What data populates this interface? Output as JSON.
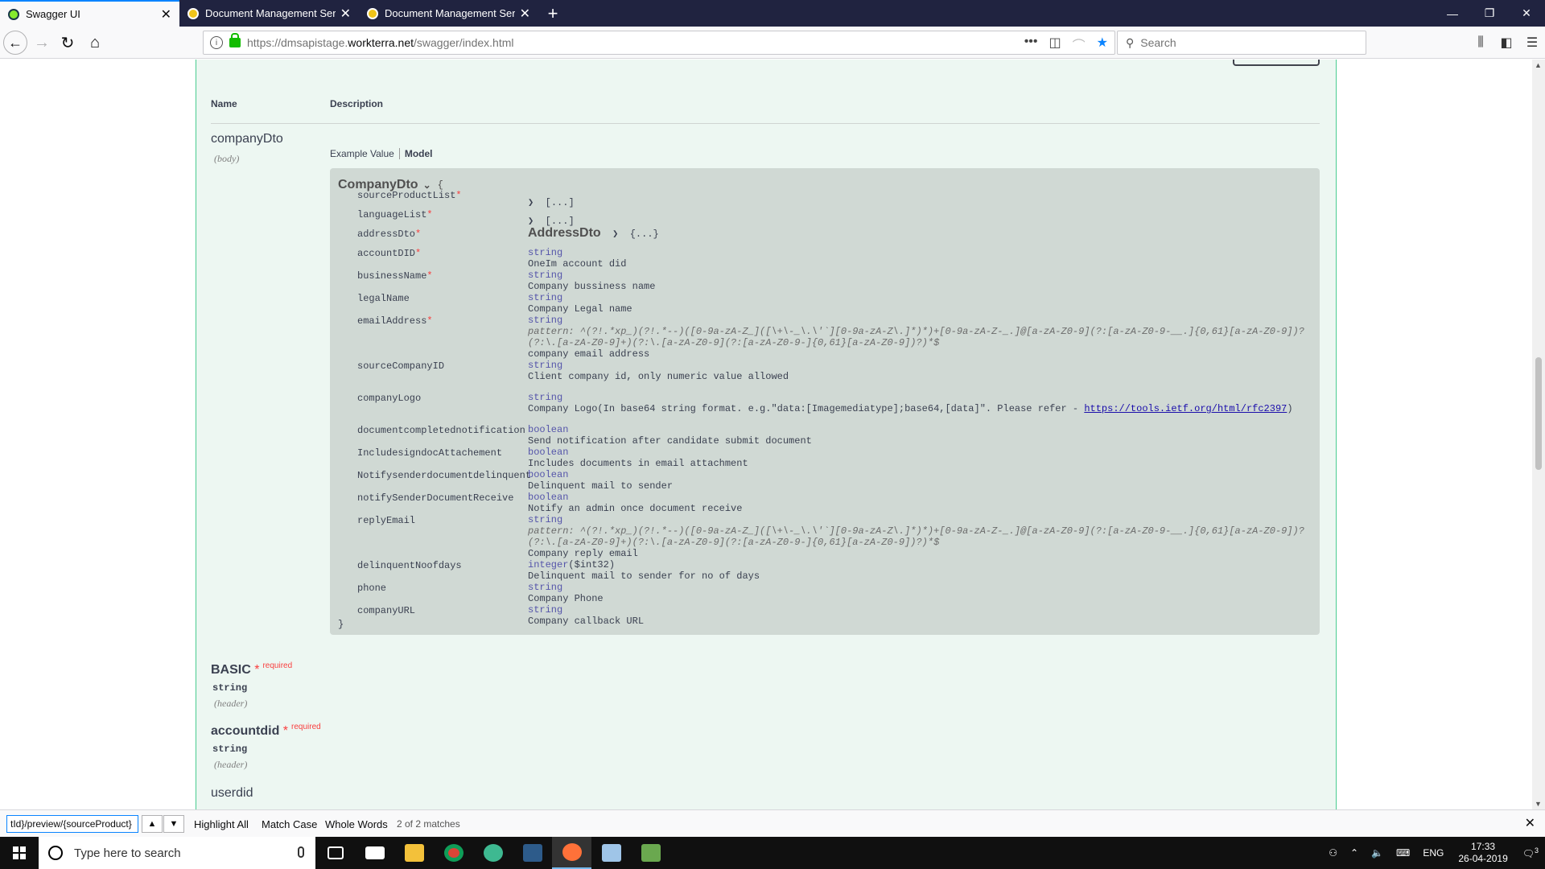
{
  "browser": {
    "tabs": [
      {
        "title": "Swagger UI",
        "active": true
      },
      {
        "title": "Document Management Servic",
        "active": false
      },
      {
        "title": "Document Management Servic",
        "active": false
      }
    ],
    "url_prefix": "https://dmsapistage.",
    "url_host": "workterra.net",
    "url_path": "/swagger/index.html",
    "search_placeholder": "Search"
  },
  "params_table": {
    "header_name": "Name",
    "header_description": "Description",
    "params": [
      {
        "name": "companyDto",
        "in": "(body)"
      },
      {
        "name": "BASIC",
        "required_star": "*",
        "required_label": "required",
        "type": "string",
        "in": "(header)"
      },
      {
        "name": "accountdid",
        "required_star": "*",
        "required_label": "required",
        "type": "string",
        "in": "(header)"
      },
      {
        "name": "userdid"
      }
    ]
  },
  "model_tabs": {
    "example": "Example Value",
    "model": "Model"
  },
  "model": {
    "title": "CompanyDto",
    "open_brace": "{",
    "close_brace": "}",
    "collapsed": "[...]",
    "collapsed_obj": "{...}",
    "address_type": "AddressDto",
    "props": {
      "sourceProductList": "sourceProductList",
      "languageList": "languageList",
      "addressDto": "addressDto",
      "accountDID": "accountDID",
      "businessName": "businessName",
      "legalName": "legalName",
      "emailAddress": "emailAddress",
      "sourceCompanyID": "sourceCompanyID",
      "companyLogo": "companyLogo",
      "documentcompletednotification": "documentcompletednotification",
      "IncludesigndocAttachement": "IncludesigndocAttachement",
      "NotifysenderdocumentdelinquentHidden": "Notifysenderdocumentdelinquent",
      "notifySenderDocumentReceive": "notifySenderDocumentReceive",
      "replyEmail": "replyEmail",
      "delinquentNoofdays": "delinquentNoofdays",
      "phone": "phone",
      "companyURL": "companyURL"
    },
    "req_star": "*",
    "types": {
      "string": "string",
      "boolean": "boolean",
      "integer": "integer",
      "int32": "($int32)"
    },
    "descs": {
      "accountDID": "OneIm account did",
      "businessName": "Company bussiness name",
      "legalName": "Company Legal name",
      "emailAddress": "company email address",
      "sourceCompanyID": "Client company id, only numeric value allowed",
      "companyLogo_pre": "Company Logo(In base64 string format. e.g.\"data:[Imagemediatype];base64,[data]\". Please refer - ",
      "companyLogo_link": "https://tools.ietf.org/html/rfc2397",
      "companyLogo_post": ")",
      "documentcompletednotification": "Send notification after candidate submit document",
      "IncludesigndocAttachement": "Includes documents in email attachment",
      "Notifysenderdocumentdelinquent": "Delinquent mail to sender",
      "notifySenderDocumentReceive": "Notify an admin once document receive",
      "replyEmail": "Company reply email",
      "delinquentNoofdays": "Delinquent mail to sender for no of days",
      "phone": "Company Phone",
      "companyURL": "Company callback URL"
    },
    "pattern_line1": "pattern: ^(?!.*xp_)(?!.*--)([0-9a-zA-Z_]([\\+\\-_\\.\\'`][0-9a-zA-Z\\.]*)*)+[0-9a-zA-Z-_.]@[a-zA-Z0-9](?:[a-zA-Z0-9-__.]{0,61}[a-zA-Z0-9])?",
    "pattern_line2": "(?:\\.[a-zA-Z0-9]+)(?:\\.[a-zA-Z0-9](?:[a-zA-Z0-9-]{0,61}[a-zA-Z0-9])?)*$"
  },
  "findbar": {
    "query": "tId}/preview/{sourceProduct}",
    "highlight_all": "Highlight All",
    "match_case": "Match Case",
    "whole_words": "Whole Words",
    "matches": "2 of 2 matches"
  },
  "taskbar": {
    "search_placeholder": "Type here to search",
    "lang": "ENG",
    "time": "17:33",
    "date": "26-04-2019",
    "notif_count": "3"
  }
}
